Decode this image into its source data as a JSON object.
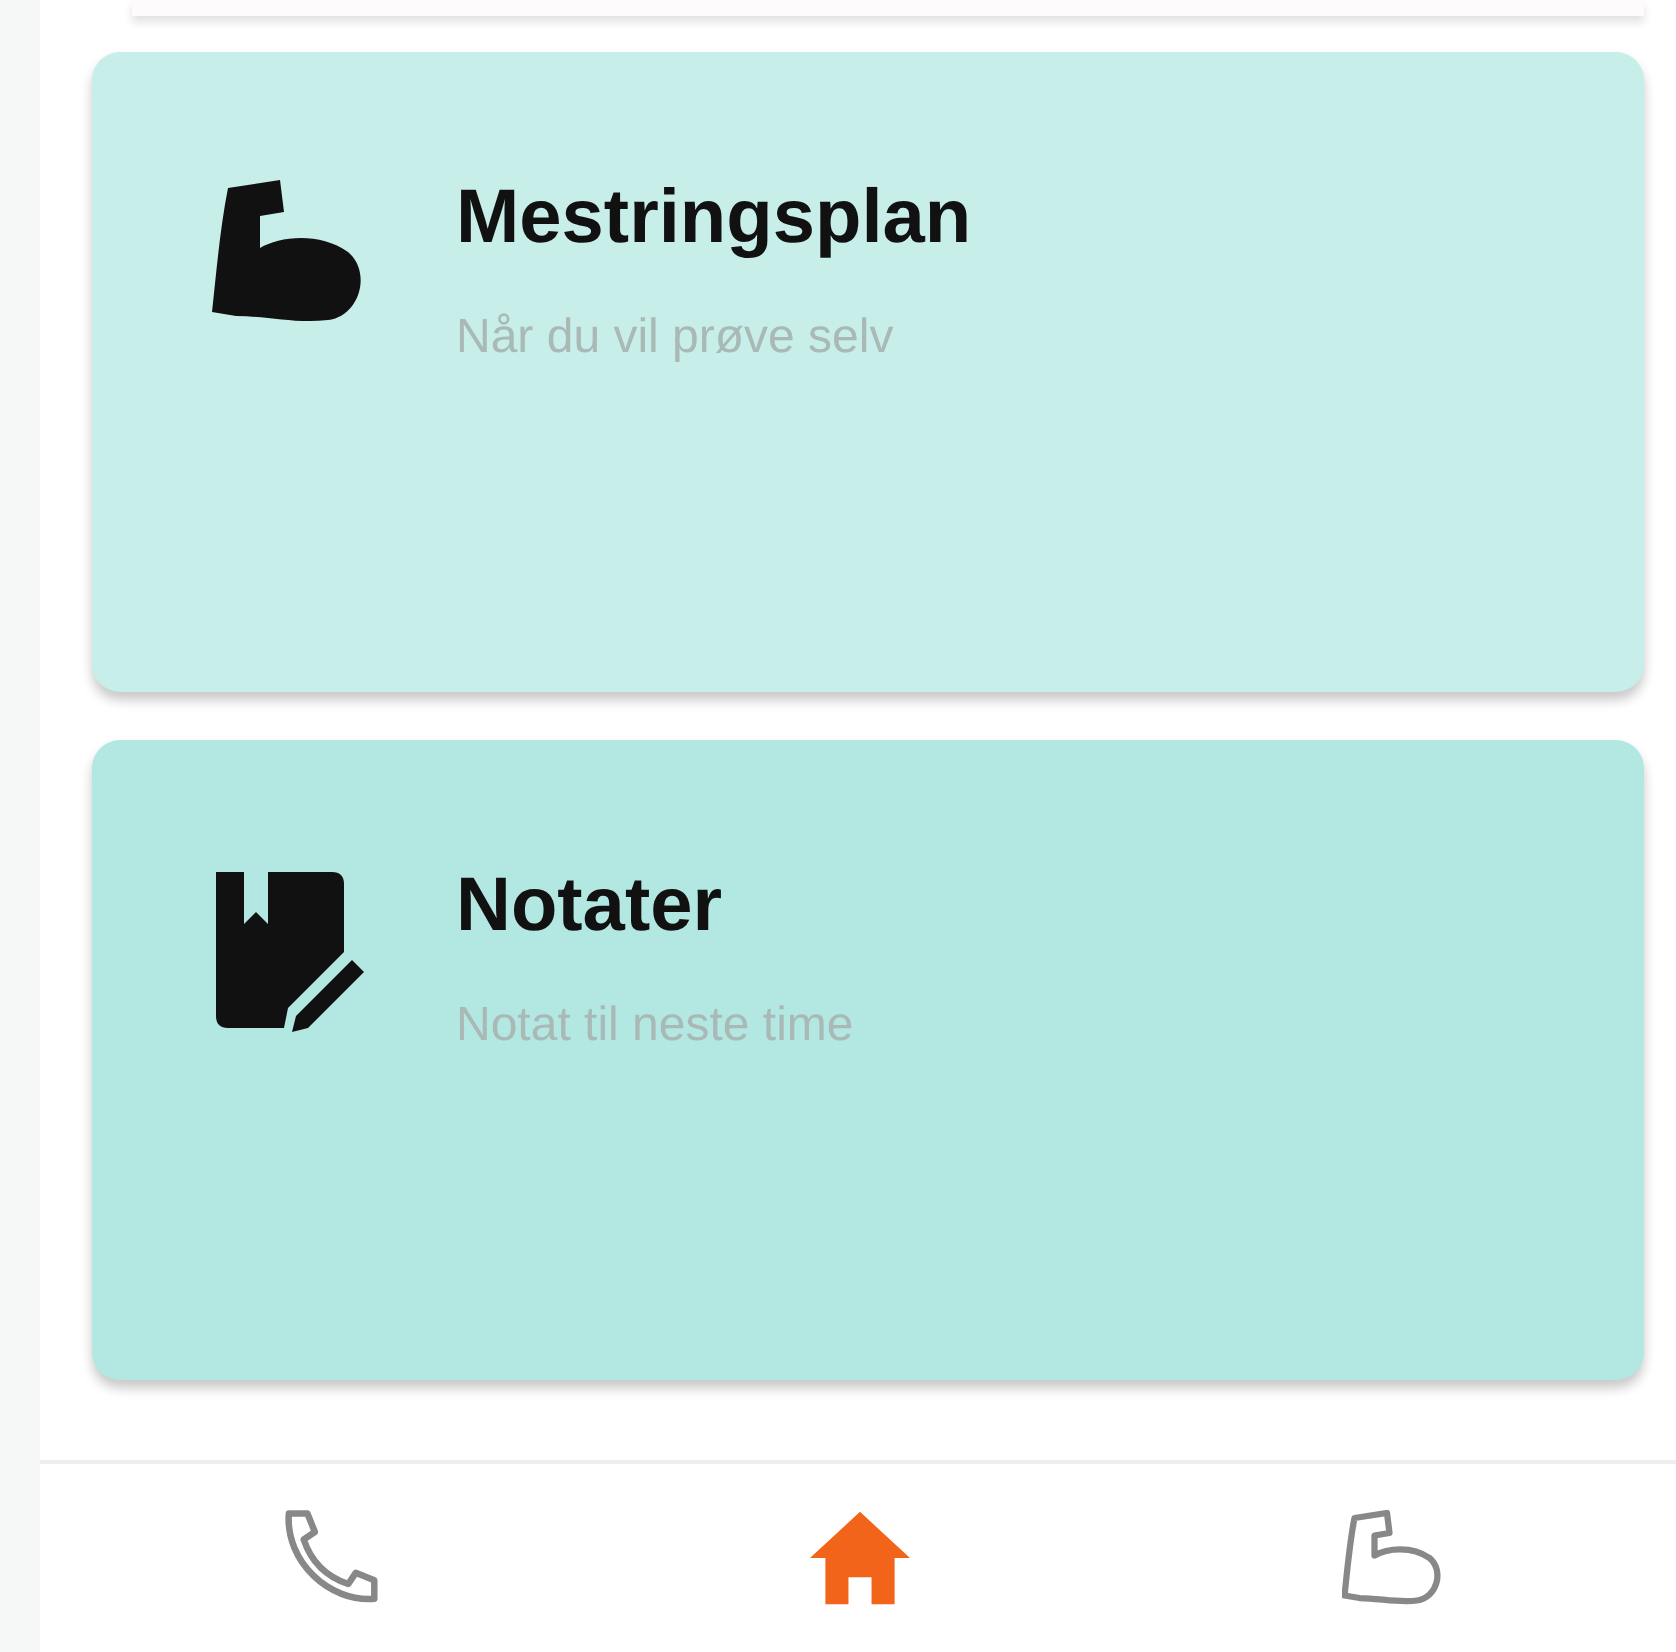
{
  "cards": [
    {
      "kind": "muscle",
      "title": "Mestringsplan",
      "subtitle": "Når du vil prøve selv",
      "color": "#c8eeea"
    },
    {
      "kind": "notes",
      "title": "Notater",
      "subtitle": "Notat til neste time",
      "color": "#b3e8e2"
    }
  ],
  "bottom_nav": [
    {
      "kind": "phone",
      "selected": false
    },
    {
      "kind": "home",
      "selected": true
    },
    {
      "kind": "muscle",
      "selected": false
    }
  ]
}
